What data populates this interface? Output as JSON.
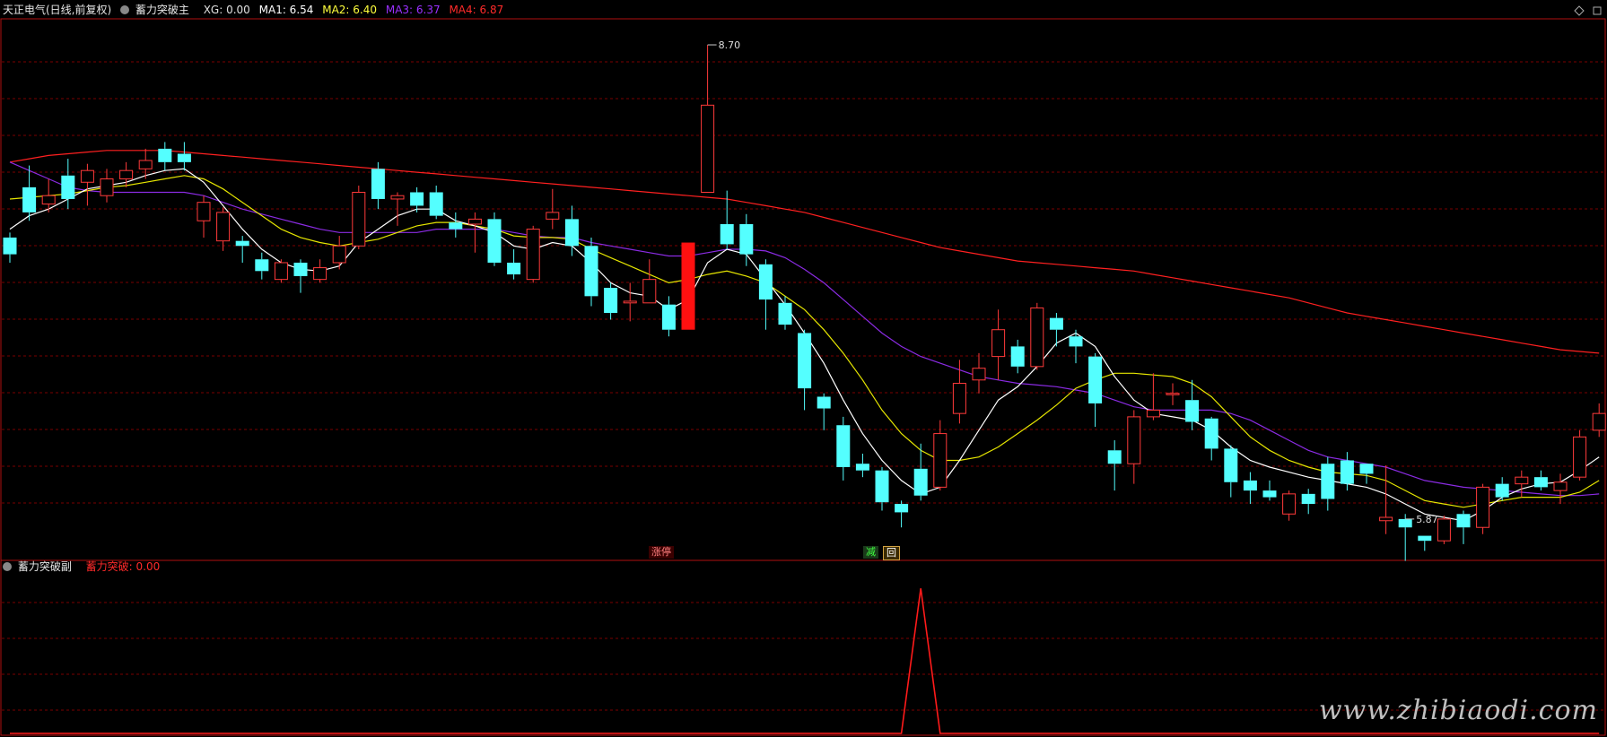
{
  "main_header": {
    "stock": "天正电气(日线,前复权)",
    "indicator": "蓄力突破主",
    "items": [
      {
        "text": "XG: 0.00",
        "color": "#e0e0e0"
      },
      {
        "text": "MA1: 6.54",
        "color": "#ffffff"
      },
      {
        "text": "MA2: 6.40",
        "color": "#ffff3c"
      },
      {
        "text": "MA3: 6.37",
        "color": "#9b30ff"
      },
      {
        "text": "MA4: 6.87",
        "color": "#ff2a2a"
      }
    ]
  },
  "sub_header": {
    "indicator": "蓄力突破副",
    "item": {
      "text": "蓄力突破: 0.00",
      "color": "#ff2a2a"
    }
  },
  "markers": {
    "limit_up": "涨停",
    "reduce": "减",
    "back": "回"
  },
  "watermark": "www.zhibiaodi.com",
  "chart_data": [
    {
      "type": "candlestick",
      "price_range": [
        5.65,
        8.85
      ],
      "grid": true,
      "annotations": [
        {
          "label": "8.70",
          "x_index": 36,
          "value": 8.7
        },
        {
          "label": "5.87",
          "x_index": 72,
          "value": 5.87
        }
      ],
      "candles": [
        [
          7.55,
          7.45,
          7.58,
          7.4
        ],
        [
          7.85,
          7.7,
          7.98,
          7.65
        ],
        [
          7.75,
          7.8,
          7.9,
          7.7
        ],
        [
          7.92,
          7.78,
          8.02,
          7.72
        ],
        [
          7.88,
          7.95,
          7.99,
          7.74
        ],
        [
          7.8,
          7.9,
          7.96,
          7.76
        ],
        [
          7.9,
          7.95,
          8.0,
          7.85
        ],
        [
          7.96,
          8.01,
          8.08,
          7.9
        ],
        [
          8.08,
          8.0,
          8.12,
          7.95
        ],
        [
          8.05,
          8.0,
          8.12,
          7.95
        ],
        [
          7.65,
          7.76,
          7.8,
          7.55
        ],
        [
          7.53,
          7.7,
          7.73,
          7.47
        ],
        [
          7.53,
          7.5,
          7.56,
          7.4
        ],
        [
          7.42,
          7.35,
          7.46,
          7.3
        ],
        [
          7.3,
          7.4,
          7.42,
          7.28
        ],
        [
          7.4,
          7.32,
          7.42,
          7.22
        ],
        [
          7.3,
          7.37,
          7.42,
          7.28
        ],
        [
          7.4,
          7.5,
          7.56,
          7.36
        ],
        [
          7.5,
          7.82,
          7.86,
          7.48
        ],
        [
          7.96,
          7.78,
          8.0,
          7.72
        ],
        [
          7.78,
          7.8,
          7.82,
          7.62
        ],
        [
          7.82,
          7.74,
          7.85,
          7.7
        ],
        [
          7.82,
          7.68,
          7.86,
          7.66
        ],
        [
          7.64,
          7.6,
          7.7,
          7.55
        ],
        [
          7.63,
          7.66,
          7.7,
          7.46
        ],
        [
          7.66,
          7.4,
          7.7,
          7.38
        ],
        [
          7.4,
          7.33,
          7.48,
          7.3
        ],
        [
          7.3,
          7.6,
          7.62,
          7.28
        ],
        [
          7.66,
          7.7,
          7.84,
          7.6
        ],
        [
          7.66,
          7.5,
          7.74,
          7.44
        ],
        [
          7.5,
          7.2,
          7.55,
          7.14
        ],
        [
          7.25,
          7.1,
          7.28,
          7.06
        ],
        [
          7.16,
          7.17,
          7.28,
          7.05
        ],
        [
          7.16,
          7.3,
          7.42,
          7.2
        ],
        [
          7.15,
          7.0,
          7.2,
          6.96
        ],
        [
          7.0,
          7.52,
          7.52,
          7.0
        ],
        [
          7.82,
          8.34,
          8.7,
          7.82
        ],
        [
          7.63,
          7.51,
          7.83,
          7.48
        ],
        [
          7.63,
          7.45,
          7.69,
          7.38
        ],
        [
          7.39,
          7.18,
          7.42,
          7.0
        ],
        [
          7.16,
          7.03,
          7.2,
          7.0
        ],
        [
          6.98,
          6.65,
          7.0,
          6.52
        ],
        [
          6.6,
          6.53,
          6.62,
          6.4
        ],
        [
          6.43,
          6.18,
          6.48,
          6.1
        ],
        [
          6.2,
          6.16,
          6.26,
          6.12
        ],
        [
          6.16,
          5.97,
          6.18,
          5.92
        ],
        [
          5.96,
          5.91,
          5.98,
          5.82
        ],
        [
          6.17,
          6.01,
          6.32,
          5.98
        ],
        [
          6.06,
          6.38,
          6.46,
          6.04
        ],
        [
          6.5,
          6.68,
          6.82,
          6.44
        ],
        [
          6.7,
          6.77,
          6.86,
          6.62
        ],
        [
          6.84,
          7.0,
          7.12,
          6.7
        ],
        [
          6.9,
          6.78,
          6.94,
          6.74
        ],
        [
          6.78,
          7.13,
          7.16,
          6.76
        ],
        [
          7.07,
          7.0,
          7.1,
          6.9
        ],
        [
          6.96,
          6.9,
          7.0,
          6.8
        ],
        [
          6.84,
          6.56,
          6.86,
          6.42
        ],
        [
          6.28,
          6.2,
          6.34,
          6.04
        ],
        [
          6.2,
          6.48,
          6.52,
          6.08
        ],
        [
          6.48,
          6.52,
          6.74,
          6.46
        ],
        [
          6.62,
          6.62,
          6.68,
          6.55
        ],
        [
          6.58,
          6.45,
          6.7,
          6.4
        ],
        [
          6.47,
          6.29,
          6.48,
          6.22
        ],
        [
          6.29,
          6.09,
          6.31,
          6.0
        ],
        [
          6.1,
          6.04,
          6.15,
          5.96
        ],
        [
          6.04,
          6.0,
          6.1,
          5.98
        ],
        [
          5.9,
          6.02,
          6.04,
          5.86
        ],
        [
          6.02,
          5.96,
          6.05,
          5.9
        ],
        [
          6.2,
          5.99,
          6.24,
          5.92
        ],
        [
          6.22,
          6.08,
          6.27,
          6.04
        ],
        [
          6.2,
          6.14,
          6.2,
          6.08
        ],
        [
          5.86,
          5.88,
          6.19,
          5.78
        ],
        [
          5.87,
          5.82,
          5.9,
          5.62
        ],
        [
          5.77,
          5.74,
          5.77,
          5.68
        ],
        [
          5.74,
          5.87,
          5.89,
          5.72
        ],
        [
          5.9,
          5.82,
          5.92,
          5.72
        ],
        [
          5.82,
          6.06,
          6.08,
          5.78
        ],
        [
          6.08,
          6.0,
          6.12,
          5.98
        ],
        [
          6.08,
          6.12,
          6.16,
          6.0
        ],
        [
          6.12,
          6.06,
          6.16,
          6.04
        ],
        [
          6.04,
          6.09,
          6.14,
          5.96
        ],
        [
          6.12,
          6.36,
          6.4,
          6.1
        ],
        [
          6.4,
          6.5,
          6.56,
          6.36
        ]
      ],
      "ma1": [
        7.6,
        7.68,
        7.72,
        7.78,
        7.84,
        7.86,
        7.88,
        7.92,
        7.95,
        7.96,
        7.88,
        7.74,
        7.6,
        7.48,
        7.4,
        7.36,
        7.35,
        7.38,
        7.52,
        7.6,
        7.68,
        7.72,
        7.72,
        7.65,
        7.62,
        7.58,
        7.5,
        7.48,
        7.52,
        7.5,
        7.4,
        7.28,
        7.22,
        7.2,
        7.12,
        7.18,
        7.4,
        7.48,
        7.45,
        7.3,
        7.15,
        6.98,
        6.8,
        6.58,
        6.38,
        6.22,
        6.1,
        6.02,
        6.06,
        6.22,
        6.4,
        6.58,
        6.66,
        6.78,
        6.92,
        6.98,
        6.9,
        6.72,
        6.58,
        6.5,
        6.48,
        6.46,
        6.4,
        6.3,
        6.22,
        6.18,
        6.15,
        6.12,
        6.1,
        6.08,
        6.06,
        6.02,
        5.96,
        5.9,
        5.88,
        5.86,
        5.92,
        6.0,
        6.05,
        6.08,
        6.09,
        6.16,
        6.24
      ],
      "ma2": [
        7.78,
        7.79,
        7.8,
        7.81,
        7.83,
        7.85,
        7.86,
        7.88,
        7.9,
        7.92,
        7.9,
        7.84,
        7.76,
        7.68,
        7.6,
        7.55,
        7.52,
        7.5,
        7.52,
        7.54,
        7.58,
        7.62,
        7.64,
        7.64,
        7.62,
        7.6,
        7.56,
        7.55,
        7.55,
        7.54,
        7.48,
        7.43,
        7.38,
        7.33,
        7.28,
        7.3,
        7.33,
        7.35,
        7.32,
        7.28,
        7.2,
        7.12,
        7.0,
        6.86,
        6.7,
        6.52,
        6.38,
        6.28,
        6.22,
        6.22,
        6.24,
        6.3,
        6.38,
        6.46,
        6.55,
        6.65,
        6.7,
        6.74,
        6.74,
        6.73,
        6.72,
        6.68,
        6.6,
        6.48,
        6.36,
        6.28,
        6.22,
        6.18,
        6.15,
        6.14,
        6.13,
        6.1,
        6.04,
        5.98,
        5.96,
        5.94,
        5.96,
        5.98,
        6.0,
        6.0,
        6.0,
        6.03,
        6.1
      ],
      "ma3": [
        8.0,
        7.95,
        7.9,
        7.85,
        7.83,
        7.82,
        7.82,
        7.82,
        7.82,
        7.82,
        7.8,
        7.76,
        7.72,
        7.69,
        7.66,
        7.63,
        7.6,
        7.58,
        7.58,
        7.58,
        7.58,
        7.58,
        7.6,
        7.6,
        7.6,
        7.6,
        7.58,
        7.56,
        7.55,
        7.55,
        7.52,
        7.5,
        7.48,
        7.46,
        7.44,
        7.44,
        7.46,
        7.48,
        7.48,
        7.47,
        7.43,
        7.36,
        7.28,
        7.18,
        7.08,
        6.98,
        6.9,
        6.84,
        6.8,
        6.76,
        6.72,
        6.7,
        6.68,
        6.67,
        6.66,
        6.64,
        6.62,
        6.58,
        6.54,
        6.52,
        6.52,
        6.52,
        6.52,
        6.5,
        6.46,
        6.4,
        6.34,
        6.28,
        6.24,
        6.22,
        6.2,
        6.18,
        6.14,
        6.1,
        6.08,
        6.06,
        6.05,
        6.04,
        6.03,
        6.02,
        6.01,
        6.01,
        6.02
      ],
      "ma4": [
        8.0,
        8.02,
        8.04,
        8.05,
        8.06,
        8.07,
        8.07,
        8.07,
        8.07,
        8.06,
        8.05,
        8.04,
        8.03,
        8.02,
        8.01,
        8.0,
        7.99,
        7.98,
        7.97,
        7.96,
        7.95,
        7.94,
        7.93,
        7.92,
        7.91,
        7.9,
        7.89,
        7.88,
        7.87,
        7.86,
        7.85,
        7.84,
        7.83,
        7.82,
        7.81,
        7.8,
        7.79,
        7.78,
        7.76,
        7.74,
        7.72,
        7.7,
        7.67,
        7.64,
        7.61,
        7.58,
        7.55,
        7.52,
        7.49,
        7.47,
        7.45,
        7.43,
        7.41,
        7.4,
        7.39,
        7.38,
        7.37,
        7.36,
        7.35,
        7.33,
        7.31,
        7.29,
        7.27,
        7.25,
        7.23,
        7.21,
        7.19,
        7.16,
        7.13,
        7.1,
        7.08,
        7.06,
        7.04,
        7.02,
        7.0,
        6.98,
        6.96,
        6.94,
        6.92,
        6.9,
        6.88,
        6.87,
        6.86
      ],
      "limit_up_index": 35
    },
    {
      "type": "line",
      "name": "蓄力突破",
      "ylim": [
        0,
        1.1
      ],
      "values_by_index": {
        "47": 1
      }
    }
  ]
}
